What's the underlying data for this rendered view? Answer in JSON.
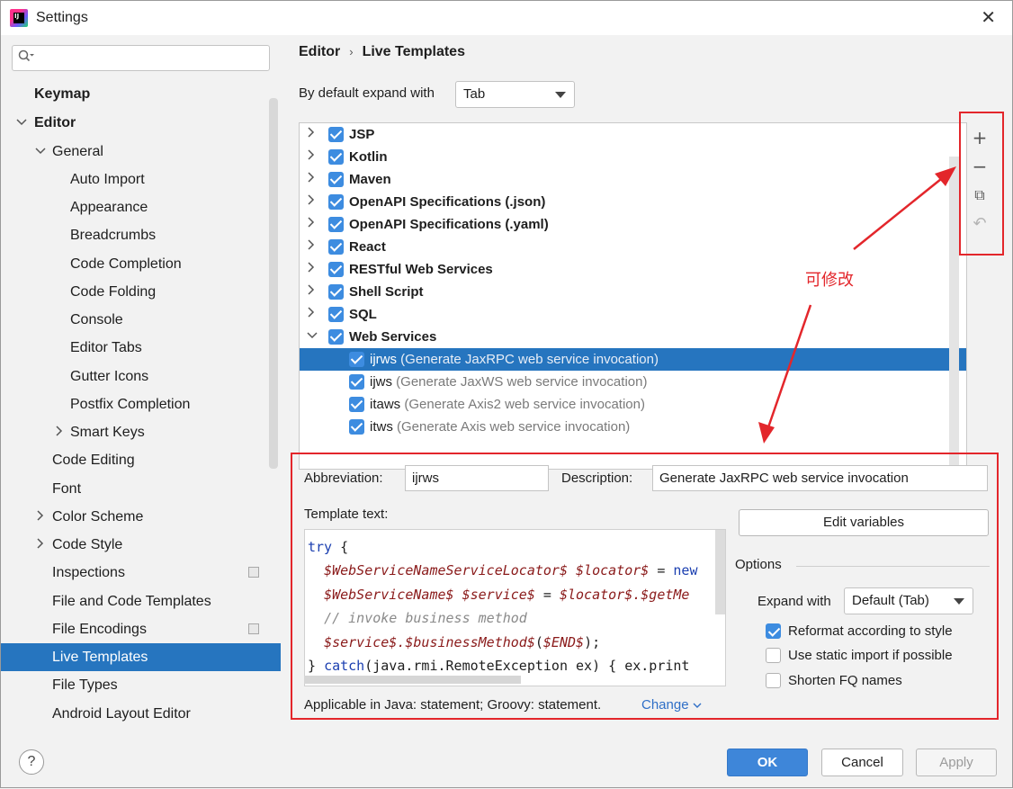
{
  "window": {
    "title": "Settings",
    "close_glyph": "✕",
    "app_icon_text": "IJ"
  },
  "search": {
    "placeholder": "",
    "icon": "search-icon"
  },
  "sidebar": {
    "items": [
      {
        "label": "Keymap"
      },
      {
        "label": "Editor"
      },
      {
        "label": "General"
      },
      {
        "label": "Auto Import"
      },
      {
        "label": "Appearance"
      },
      {
        "label": "Breadcrumbs"
      },
      {
        "label": "Code Completion"
      },
      {
        "label": "Code Folding"
      },
      {
        "label": "Console"
      },
      {
        "label": "Editor Tabs"
      },
      {
        "label": "Gutter Icons"
      },
      {
        "label": "Postfix Completion"
      },
      {
        "label": "Smart Keys"
      },
      {
        "label": "Code Editing"
      },
      {
        "label": "Font"
      },
      {
        "label": "Color Scheme"
      },
      {
        "label": "Code Style"
      },
      {
        "label": "Inspections"
      },
      {
        "label": "File and Code Templates"
      },
      {
        "label": "File Encodings"
      },
      {
        "label": "Live Templates"
      },
      {
        "label": "File Types"
      },
      {
        "label": "Android Layout Editor"
      }
    ]
  },
  "breadcrumb": {
    "parent": "Editor",
    "current": "Live Templates",
    "separator": "›"
  },
  "expand": {
    "label": "By default expand with",
    "value": "Tab"
  },
  "template_groups": [
    {
      "name": "JSP"
    },
    {
      "name": "Kotlin"
    },
    {
      "name": "Maven"
    },
    {
      "name": "OpenAPI Specifications (.json)"
    },
    {
      "name": "OpenAPI Specifications (.yaml)"
    },
    {
      "name": "React"
    },
    {
      "name": "RESTful Web Services"
    },
    {
      "name": "Shell Script"
    },
    {
      "name": "SQL"
    },
    {
      "name": "Web Services"
    }
  ],
  "templates": [
    {
      "abbr": "ijrws",
      "desc": "(Generate JaxRPC web service invocation)"
    },
    {
      "abbr": "ijws",
      "desc": "(Generate JaxWS web service invocation)"
    },
    {
      "abbr": "itaws",
      "desc": "(Generate Axis2 web service invocation)"
    },
    {
      "abbr": "itws",
      "desc": "(Generate Axis web service invocation)"
    }
  ],
  "toolbar": {
    "add": "+",
    "remove": "−",
    "copy": "⧉",
    "restore": "↶"
  },
  "detail": {
    "abbreviation_label": "Abbreviation:",
    "abbreviation_value": "ijrws",
    "description_label": "Description:",
    "description_value": "Generate JaxRPC web service invocation",
    "template_text_label": "Template text:",
    "edit_variables": "Edit variables",
    "options_label": "Options",
    "expand_with_label": "Expand with",
    "expand_with_value": "Default (Tab)",
    "reformat": "Reformat according to style",
    "static_import": "Use static import if possible",
    "shorten_fq": "Shorten FQ names",
    "applicable": "Applicable in Java: statement; Groovy: statement.",
    "change": "Change"
  },
  "code": {
    "l1_kw": "try",
    "l1_rest": " {",
    "l2_v1": "$WebServiceNameServiceLocator$",
    "l2_v2": "$locator$",
    "l2_rest": " = ",
    "l2_kw": "new",
    "l3_v1": "$WebServiceName$",
    "l3_v2": "$service$",
    "l3_mid": " = ",
    "l3_v3": "$locator$",
    "l3_v4": ".$getMe",
    "l4_cm": "// invoke business method",
    "l5_v1": "$service$",
    "l5_v2": ".$businessMethod$",
    "l5_p1": "(",
    "l5_v3": "$END$",
    "l5_p2": ");",
    "l6_a": "} ",
    "l6_kw": "catch",
    "l6_rest": "(java.rmi.RemoteException ex) { ex.print"
  },
  "annotation": {
    "text": "可修改",
    "color": "#e3262b"
  },
  "footer": {
    "help": "?",
    "ok": "OK",
    "cancel": "Cancel",
    "apply": "Apply"
  }
}
